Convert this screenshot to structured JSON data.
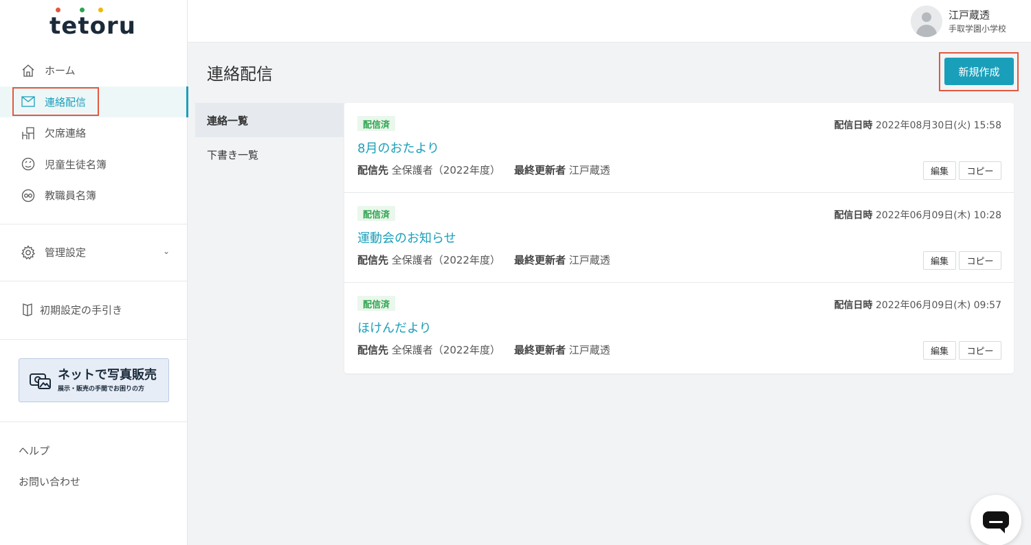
{
  "logo": {
    "text": "tetoru",
    "dot_colors": [
      "#e2583e",
      "#2ea44f",
      "#f2b705",
      "#1a9fba"
    ]
  },
  "sidebar": {
    "items": [
      {
        "label": "ホーム",
        "icon": "home-icon"
      },
      {
        "label": "連絡配信",
        "icon": "mail-icon",
        "active": true
      },
      {
        "label": "欠席連絡",
        "icon": "desk-chair-icon"
      },
      {
        "label": "児童生徒名簿",
        "icon": "student-face-icon"
      },
      {
        "label": "教職員名簿",
        "icon": "staff-glasses-icon"
      }
    ],
    "admin_label": "管理設定",
    "guide_label": "初期設定の手引き",
    "banner": {
      "title": "ネットで写真販売",
      "subtitle": "展示・販売の手間でお困りの方"
    },
    "help_label": "ヘルプ",
    "contact_label": "お問い合わせ"
  },
  "user": {
    "name": "江戸蔵透",
    "school": "手取学園小学校"
  },
  "page": {
    "title": "連絡配信",
    "new_button": "新規作成"
  },
  "subnav": [
    {
      "label": "連絡一覧",
      "active": true
    },
    {
      "label": "下書き一覧"
    }
  ],
  "messages": [
    {
      "status": "配信済",
      "date_label": "配信日時",
      "date": "2022年08月30日(火) 15:58",
      "title": "8月のおたより",
      "dest_label": "配信先",
      "dest": "全保護者（2022年度）",
      "updater_label": "最終更新者",
      "updater": "江戸蔵透",
      "edit_label": "編集",
      "copy_label": "コピー"
    },
    {
      "status": "配信済",
      "date_label": "配信日時",
      "date": "2022年06月09日(木) 10:28",
      "title": "運動会のお知らせ",
      "dest_label": "配信先",
      "dest": "全保護者（2022年度）",
      "updater_label": "最終更新者",
      "updater": "江戸蔵透",
      "edit_label": "編集",
      "copy_label": "コピー"
    },
    {
      "status": "配信済",
      "date_label": "配信日時",
      "date": "2022年06月09日(木) 09:57",
      "title": "ほけんだより",
      "dest_label": "配信先",
      "dest": "全保護者（2022年度）",
      "updater_label": "最終更新者",
      "updater": "江戸蔵透",
      "edit_label": "編集",
      "copy_label": "コピー"
    }
  ],
  "colors": {
    "accent": "#1a9fba",
    "highlight": "#e2583e",
    "status_green": "#2ea44f"
  }
}
